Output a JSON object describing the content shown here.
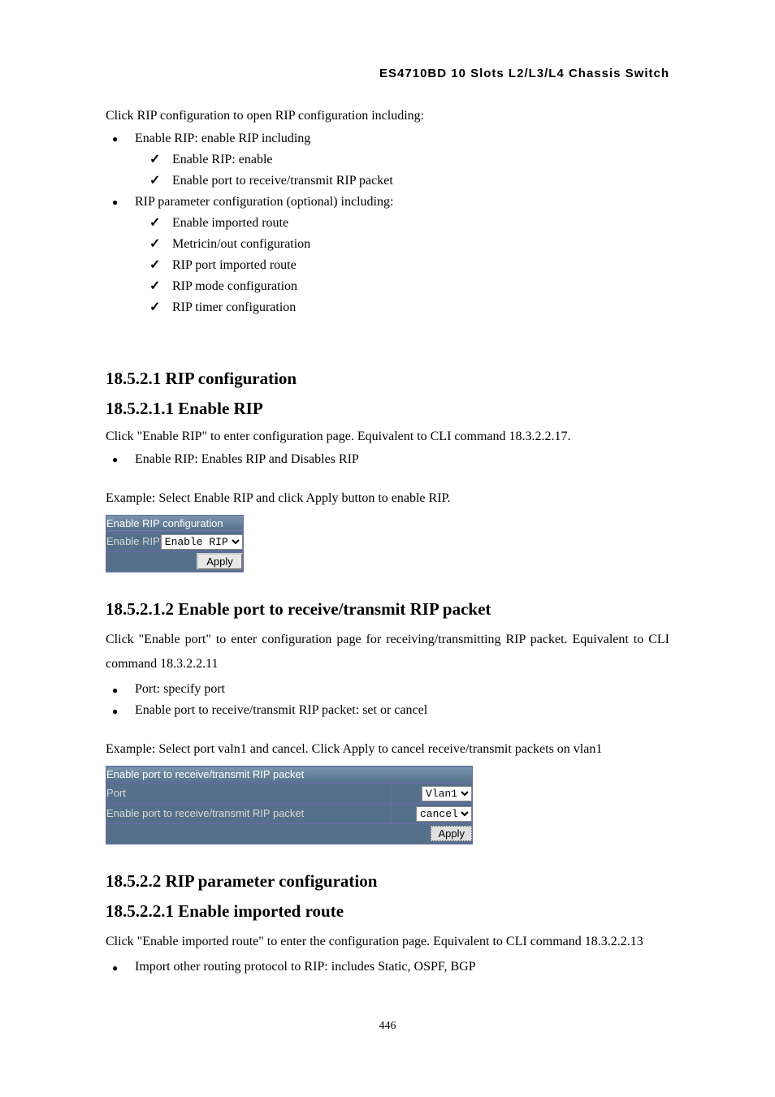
{
  "header_title": "ES4710BD 10 Slots L2/L3/L4 Chassis Switch",
  "intro": "Click RIP configuration to open RIP configuration including:",
  "list1": [
    "Enable RIP: enable RIP including",
    "RIP parameter configuration (optional) including:"
  ],
  "list1_sub1": [
    "Enable RIP: enable",
    "Enable port to receive/transmit RIP packet"
  ],
  "list1_sub2": [
    "Enable imported route",
    "Metricin/out configuration",
    "RIP port imported route",
    "RIP mode configuration",
    "RIP timer configuration"
  ],
  "h_18_5_2_1": "18.5.2.1   RIP configuration",
  "h_18_5_2_1_1": "18.5.2.1.1   Enable RIP",
  "p_enable_rip_1": "Click \"Enable RIP\"   to enter configuration page. Equivalent to CLI command 18.3.2.2.17.",
  "list_enable_rip": [
    "Enable RIP: Enables RIP and Disables RIP"
  ],
  "p_enable_rip_ex": "Example: Select Enable RIP and click Apply button to enable RIP.",
  "form1": {
    "header": "Enable RIP configuration",
    "row_label": "Enable RIP",
    "select_value": "Enable RIP",
    "apply": "Apply"
  },
  "h_18_5_2_1_2": "18.5.2.1.2   Enable port to receive/transmit RIP packet",
  "p_enable_port_1": "Click \"Enable port\" to enter configuration page for receiving/transmitting RIP packet. Equivalent to CLI command 18.3.2.2.11",
  "list_enable_port": [
    "Port: specify port",
    "Enable port to receive/transmit RIP packet: set or cancel"
  ],
  "p_enable_port_ex": "Example: Select port valn1 and cancel. Click Apply to cancel receive/transmit packets on vlan1",
  "form2": {
    "header": "Enable port to receive/transmit RIP packet",
    "row1_label": "Port",
    "row1_value": "Vlan1",
    "row2_label": "Enable port to receive/transmit RIP packet",
    "row2_value": "cancel",
    "apply": "Apply"
  },
  "h_18_5_2_2": "18.5.2.2   RIP parameter configuration",
  "h_18_5_2_2_1": "18.5.2.2.1   Enable imported route",
  "p_import_1": "Click \"Enable imported route\" to enter the configuration page. Equivalent to CLI command 18.3.2.2.13",
  "list_import": [
    "Import other routing protocol to RIP: includes Static, OSPF, BGP"
  ],
  "page_number": "446"
}
